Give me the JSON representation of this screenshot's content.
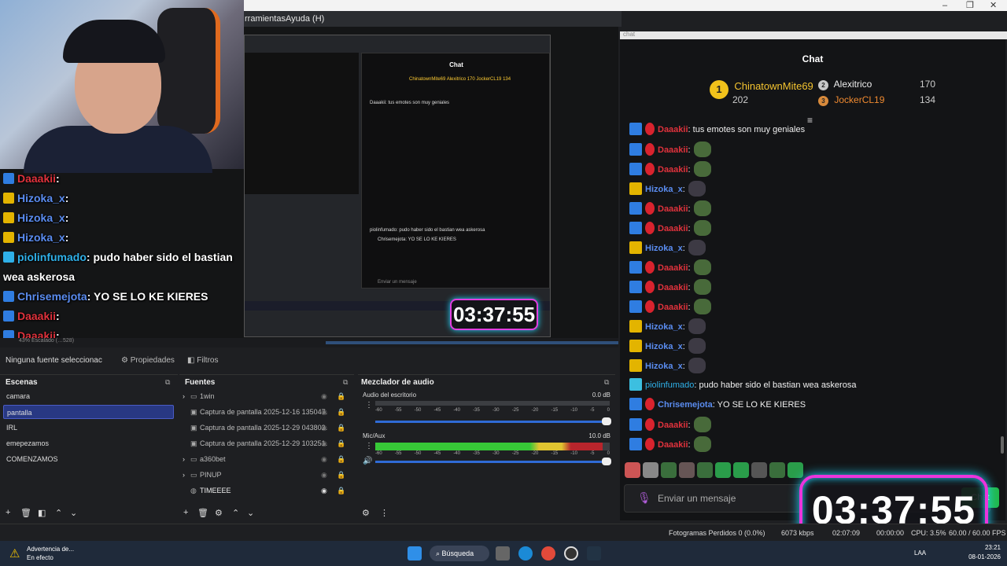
{
  "window": {
    "minimize": "–",
    "maximize": "❐",
    "close": "✕"
  },
  "menu": {
    "tools": "rramientas",
    "help": "Ayuda (H)"
  },
  "preview": {
    "mini_chat_title": "Chat",
    "mini_leader": "ChinatownMite69  Alexitrico 170  JockerCL19 134",
    "mini_messages": [
      "Daaakii: tus emotes son muy geniales",
      "piolinfumado: pudo haber sido el bastian wea askerosa",
      "Chrisemejota: YO SE LO KE KIERES",
      "Enviar un mensaje"
    ],
    "mini_timer": "03:37:55",
    "zoom_text": "43%    Escalado (…528)"
  },
  "overlay_chat": [
    {
      "user": "Daaakii",
      "text": ":",
      "color": "#e0323c"
    },
    {
      "user": "Hizoka_x",
      "text": ":",
      "color": "#5a8cf0"
    },
    {
      "user": "Hizoka_x",
      "text": ":",
      "color": "#5a8cf0"
    },
    {
      "user": "Hizoka_x",
      "text": ":",
      "color": "#5a8cf0"
    },
    {
      "user": "piolinfumado",
      "text": ": pudo haber sido el bastian",
      "color": "#2fb0e8"
    },
    {
      "user": "",
      "text": "wea askerosa",
      "color": "#fff"
    },
    {
      "user": "Chrisemejota",
      "text": ": YO SE LO KE KIERES",
      "color": "#5a8cf0"
    },
    {
      "user": "Daaakii",
      "text": ":",
      "color": "#e0323c"
    },
    {
      "user": "Daaakii",
      "text": ":",
      "color": "#e0323c"
    }
  ],
  "source_bar": {
    "no_source": "Ninguna fuente seleccionac",
    "properties": "Propiedades",
    "filters": "Filtros"
  },
  "scenes": {
    "title": "Escenas",
    "items": [
      "camara",
      "pantalla",
      "IRL",
      "emepezamos",
      "COMENZAMOS"
    ],
    "selected": "pantalla"
  },
  "sources": {
    "title": "Fuentes",
    "items": [
      {
        "name": "1win",
        "type": "folder"
      },
      {
        "name": "Captura de pantalla 2025-12-16 135047.",
        "type": "image"
      },
      {
        "name": "Captura de pantalla 2025-12-29 043802.",
        "type": "image"
      },
      {
        "name": "Captura de pantalla 2025-12-29 103251.",
        "type": "image"
      },
      {
        "name": "a360bet",
        "type": "folder"
      },
      {
        "name": "PINUP",
        "type": "folder"
      },
      {
        "name": "TIMEEEE",
        "type": "browser"
      }
    ]
  },
  "mixer": {
    "title": "Mezclador de audio",
    "channels": [
      {
        "name": "Audio del escritorio",
        "db": "0.0 dB",
        "level": 0.0
      },
      {
        "name": "Mic/Aux",
        "db": "10.0 dB",
        "level": 0.97
      }
    ],
    "ticks": [
      "-60",
      "-55",
      "-50",
      "-45",
      "-40",
      "-35",
      "-30",
      "-25",
      "-20",
      "-15",
      "-10",
      "-5",
      "0"
    ]
  },
  "chat": {
    "browser_title": "chat",
    "title": "Chat",
    "leader1": {
      "name": "ChinatownMite69",
      "rank": "1",
      "points": "202"
    },
    "leader2": {
      "name": "Alexitrico",
      "rank": "2",
      "points": "170"
    },
    "leader3": {
      "name": "JockerCL19",
      "rank": "3",
      "points": "134"
    },
    "messages": [
      {
        "user": "Daaakii",
        "text": ": tus emotes son muy geniales",
        "badge": "pr",
        "cls": "u-red"
      },
      {
        "user": "Daaakii",
        "text": ":",
        "badge": "pr",
        "cls": "u-red"
      },
      {
        "user": "Daaakii",
        "text": ":",
        "badge": "pr",
        "cls": "u-red"
      },
      {
        "user": "Hizoka_x",
        "text": ":",
        "badge": "sub",
        "cls": "u-blue"
      },
      {
        "user": "Daaakii",
        "text": ":",
        "badge": "pr",
        "cls": "u-red"
      },
      {
        "user": "Daaakii",
        "text": ":",
        "badge": "pr",
        "cls": "u-red"
      },
      {
        "user": "Hizoka_x",
        "text": ":",
        "badge": "sub",
        "cls": "u-blue"
      },
      {
        "user": "Daaakii",
        "text": ":",
        "badge": "pr",
        "cls": "u-red"
      },
      {
        "user": "Daaakii",
        "text": ":",
        "badge": "pr",
        "cls": "u-red"
      },
      {
        "user": "Daaakii",
        "text": ":",
        "badge": "pr",
        "cls": "u-red"
      },
      {
        "user": "Hizoka_x",
        "text": ":",
        "badge": "sub",
        "cls": "u-blue"
      },
      {
        "user": "Hizoka_x",
        "text": ":",
        "badge": "sub",
        "cls": "u-blue"
      },
      {
        "user": "Hizoka_x",
        "text": ":",
        "badge": "sub",
        "cls": "u-blue"
      },
      {
        "user": "piolinfumado",
        "text": ": pudo haber sido el bastian wea askerosa",
        "badge": "gift",
        "cls": "u-cyan"
      },
      {
        "user": "Chrisemejota",
        "text": ": YO SE LO KE KIERES",
        "badge": "pr",
        "cls": "u-blue"
      },
      {
        "user": "Daaakii",
        "text": ":",
        "badge": "pr",
        "cls": "u-red"
      },
      {
        "user": "Daaakii",
        "text": ":",
        "badge": "pr",
        "cls": "u-red"
      }
    ],
    "input_placeholder": "Enviar un mensaje",
    "send": "Chat",
    "timer": "03:37:55"
  },
  "statusbar": {
    "dropped": "Fotogramas Perdidos 0 (0.0%)",
    "kbps": "6073 kbps",
    "stream_time": "02:07:09",
    "rec_time": "00:00:00",
    "cpu": "CPU: 3.5%",
    "fps": "60.00 / 60.00 FPS"
  },
  "taskbar": {
    "warning_title": "Advertencia de...",
    "warning_sub": "En efecto",
    "search": "Búsqueda",
    "lang": "LAA",
    "time": "23:21",
    "date": "08-01-2026"
  },
  "colors": {
    "accent": "#283883",
    "timer_border": "#ea35dc",
    "timer_glow": "#20d8ff",
    "meter_green": "#37c837"
  }
}
